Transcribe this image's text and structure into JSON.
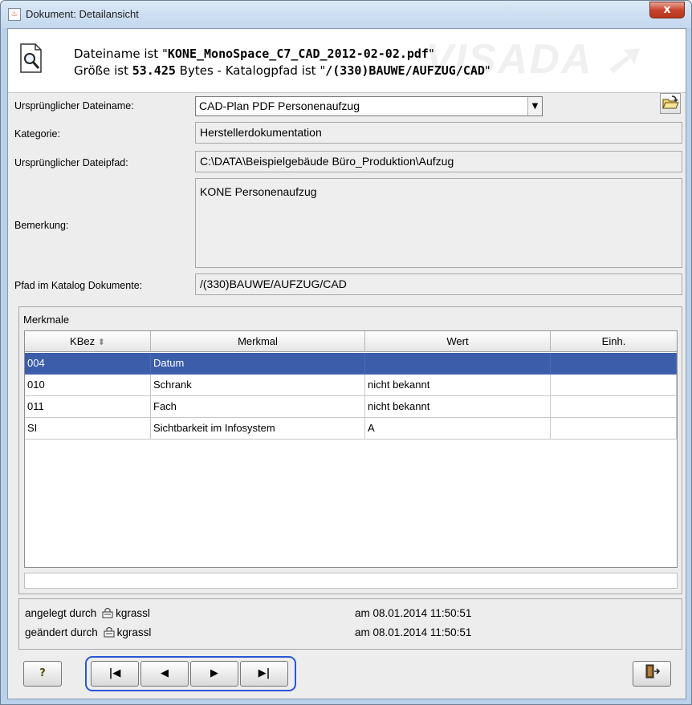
{
  "window": {
    "title": "Dokument: Detailansicht",
    "close_label": "x"
  },
  "info": {
    "watermark": "VISADA ➚",
    "line1_prefix": "Dateiname ist \"",
    "filename": "KONE_MonoSpace_C7_CAD_2012-02-02.pdf",
    "line1_suffix": "\"",
    "line2_prefix": "Größe ist ",
    "size": "53.425",
    "line2_mid": " Bytes - Katalogpfad ist \"",
    "catalog_path": "/(330)BAUWE/AUFZUG/CAD",
    "line2_suffix": "\""
  },
  "form": {
    "orig_filename_label": "Ursprünglicher Dateiname:",
    "orig_filename_value": "CAD-Plan PDF Personenaufzug",
    "category_label": "Kategorie:",
    "category_value": "Herstellerdokumentation",
    "orig_path_label": "Ursprünglicher Dateipfad:",
    "orig_path_value": "C:\\DATA\\Beispielgebäude Büro_Produktion\\Aufzug",
    "remark_label": "Bemerkung:",
    "remark_value": "KONE Personenaufzug",
    "catalog_label": "Pfad im Katalog Dokumente:",
    "catalog_value": "/(330)BAUWE/AUFZUG/CAD"
  },
  "merkmale": {
    "title": "Merkmale",
    "columns": [
      "KBez",
      "Merkmal",
      "Wert",
      "Einh."
    ],
    "sort_indicator": "⬍",
    "rows": [
      [
        "004",
        "Datum",
        "",
        ""
      ],
      [
        "010",
        "Schrank",
        "nicht bekannt",
        ""
      ],
      [
        "011",
        "Fach",
        "nicht bekannt",
        ""
      ],
      [
        "SI",
        "Sichtbarkeit im Infosystem",
        "A",
        ""
      ]
    ],
    "selected_row": 0
  },
  "audit": {
    "created_label": "angelegt durch",
    "created_user": "kgrassl",
    "created_at_label": "am",
    "created_at": "08.01.2014 11:50:51",
    "changed_label": "geändert durch",
    "changed_user": "kgrassl",
    "changed_at_label": "am",
    "changed_at": "08.01.2014 11:50:51"
  },
  "buttons": {
    "help": "?",
    "first": "|◀",
    "prev": "◀",
    "next": "▶",
    "last": "▶|"
  },
  "colors": {
    "selection": "#3b5daa",
    "nav_highlight": "#2a55d6"
  }
}
